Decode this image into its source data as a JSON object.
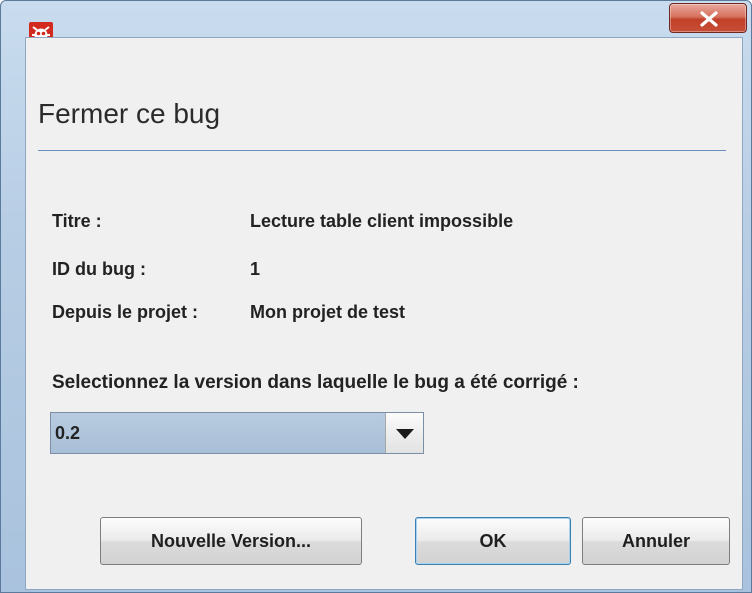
{
  "window": {
    "icon": "bug-icon",
    "accent_color": "#d32a1f"
  },
  "dialog": {
    "heading": "Fermer ce bug",
    "fields": [
      {
        "label": "Titre :",
        "value": "Lecture table client impossible"
      },
      {
        "label": "ID du bug :",
        "value": "1"
      },
      {
        "label": "Depuis le projet :",
        "value": "Mon projet de test"
      }
    ],
    "version_prompt": "Selectionnez la version dans laquelle le bug a été corrigé :",
    "version_select": {
      "selected": "0.2"
    },
    "buttons": {
      "new_version": "Nouvelle Version...",
      "ok": "OK",
      "cancel": "Annuler"
    }
  }
}
